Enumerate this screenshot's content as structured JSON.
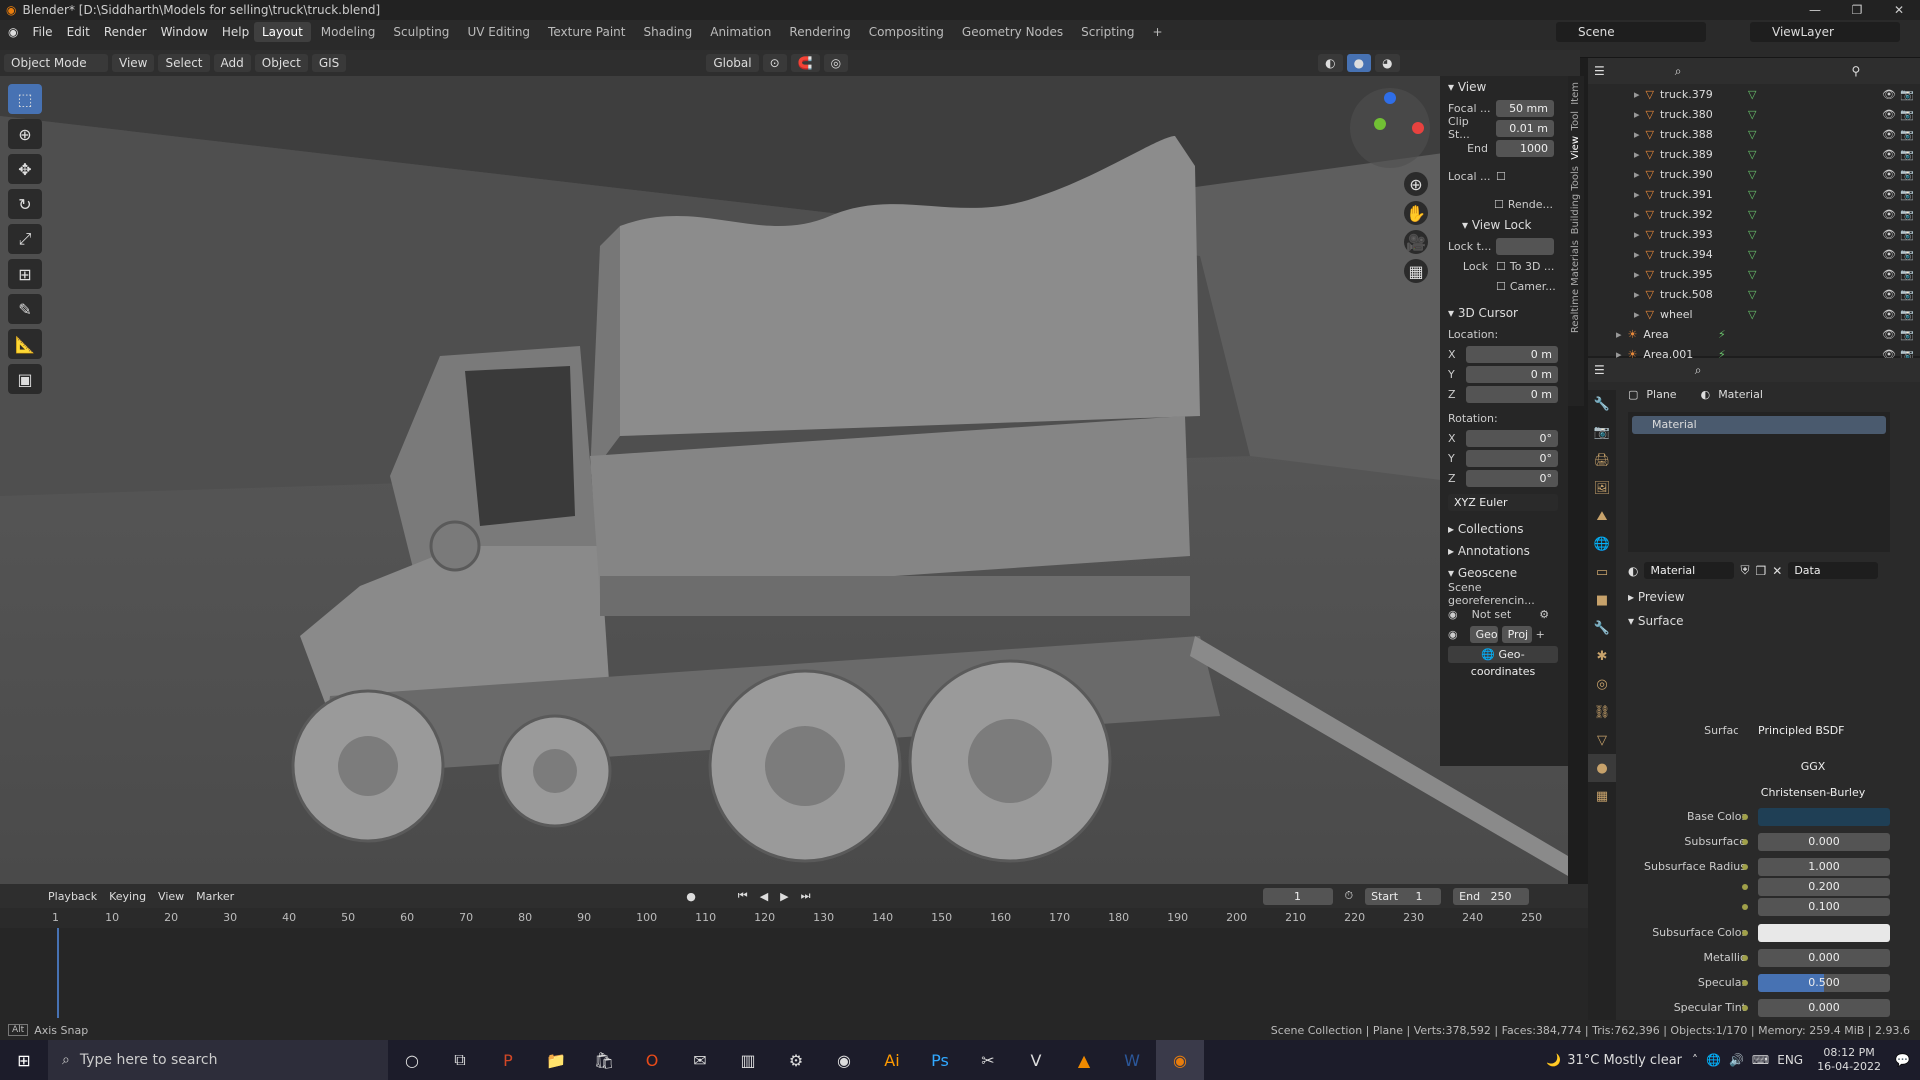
{
  "titlebar": {
    "title": "Blender* [D:\\Siddharth\\Models for selling\\truck\\truck.blend]"
  },
  "menu": [
    "File",
    "Edit",
    "Render",
    "Window",
    "Help"
  ],
  "workspaces": [
    "Layout",
    "Modeling",
    "Sculpting",
    "UV Editing",
    "Texture Paint",
    "Shading",
    "Animation",
    "Rendering",
    "Compositing",
    "Geometry Nodes",
    "Scripting"
  ],
  "scene": {
    "scene_name": "Scene",
    "view_layer": "ViewLayer"
  },
  "viewport_header": {
    "mode": "Object Mode",
    "menus": [
      "View",
      "Select",
      "Add",
      "Object",
      "GIS"
    ],
    "orientation": "Global"
  },
  "npanel": {
    "tabs": [
      "Item",
      "Tool",
      "View",
      "Building Tools",
      "Realtime Materials"
    ],
    "view": {
      "title": "View",
      "focal_label": "Focal ...",
      "focal": "50 mm",
      "clip_start_label": "Clip St...",
      "clip_start": "0.01 m",
      "end_label": "End",
      "end": "1000",
      "local_label": "Local ...",
      "render_label": "Rende..."
    },
    "view_lock": {
      "title": "View Lock",
      "lock_to_label": "Lock t...",
      "lock_label": "Lock",
      "to3d": "To 3D ...",
      "camera": "Camer..."
    },
    "cursor": {
      "title": "3D Cursor",
      "location": "Location:",
      "x": "0 m",
      "y": "0 m",
      "z": "0 m",
      "rotation": "Rotation:",
      "rx": "0°",
      "ry": "0°",
      "rz": "0°",
      "mode": "XYZ Euler"
    },
    "collections": "Collections",
    "annotations": "Annotations",
    "geoscene": {
      "title": "Geoscene",
      "georef": "Scene georeferencin...",
      "not_set": "Not set",
      "geo": "Geo",
      "proj": "Proj",
      "coords": "Geo-coordinates"
    }
  },
  "outliner": {
    "items": [
      "truck.379",
      "truck.380",
      "truck.388",
      "truck.389",
      "truck.390",
      "truck.391",
      "truck.392",
      "truck.393",
      "truck.394",
      "truck.395",
      "truck.508",
      "wheel"
    ],
    "lights": [
      "Area",
      "Area.001"
    ]
  },
  "properties": {
    "breadcrumb_obj": "Plane",
    "breadcrumb_mat": "Material",
    "slot": "Material",
    "material_name": "Material",
    "data_select": "Data",
    "preview": "Preview",
    "surface_section": "Surface",
    "surface_label": "Surface",
    "surface_value": "Principled BSDF",
    "distribution": "GGX",
    "subsurface_method": "Christensen-Burley",
    "rows": [
      {
        "label": "Base Color",
        "value": ""
      },
      {
        "label": "Subsurface",
        "value": "0.000"
      },
      {
        "label": "Subsurface Radius",
        "value": "1.000"
      },
      {
        "label": "",
        "value": "0.200"
      },
      {
        "label": "",
        "value": "0.100"
      },
      {
        "label": "Subsurface Color",
        "value": ""
      },
      {
        "label": "Metallic",
        "value": "0.000"
      },
      {
        "label": "Specular",
        "value": "0.500"
      },
      {
        "label": "Specular Tint",
        "value": "0.000"
      }
    ]
  },
  "timeline": {
    "menus": [
      "Playback",
      "Keying",
      "View",
      "Marker"
    ],
    "current": "1",
    "start_label": "Start",
    "start": "1",
    "end_label": "End",
    "end": "250",
    "ticks": [
      "1",
      "10",
      "20",
      "30",
      "40",
      "50",
      "60",
      "70",
      "80",
      "90",
      "100",
      "110",
      "120",
      "130",
      "140",
      "150",
      "160",
      "170",
      "180",
      "190",
      "200",
      "210",
      "220",
      "230",
      "240",
      "250"
    ]
  },
  "statusbar": {
    "left": "Axis Snap",
    "right": "Scene Collection | Plane | Verts:378,592 | Faces:384,774 | Tris:762,396 | Objects:1/170 | Memory: 259.4 MiB | 2.93.6"
  },
  "taskbar": {
    "search_placeholder": "Type here to search",
    "weather": "31°C  Mostly clear",
    "lang": "ENG",
    "time": "08:12 PM",
    "date": "16-04-2022"
  },
  "colors": {
    "accent": "#4772b3",
    "base_color": "#1f3f55",
    "subsurface_color": "#e8e8e8"
  }
}
